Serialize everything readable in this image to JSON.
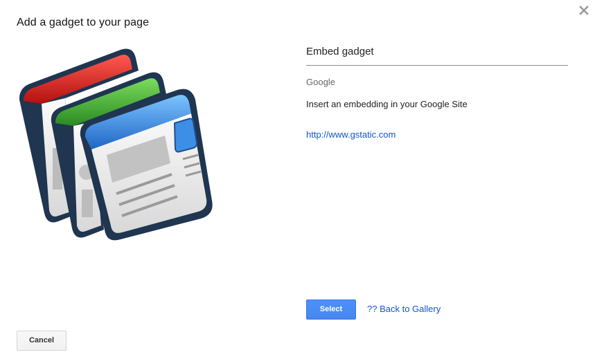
{
  "dialog": {
    "title": "Add a gadget to your page",
    "close_icon": "close-icon"
  },
  "gadget": {
    "name": "Embed gadget",
    "author": "Google",
    "description": "Insert an embedding in your Google Site",
    "url": "http://www.gstatic.com",
    "illustration_icon": "gadget-windows-icon",
    "colors": {
      "red": "#c4161c",
      "green": "#3a9d2e",
      "blue": "#2b78d8",
      "outline": "#1f3550"
    }
  },
  "actions": {
    "select_label": "Select",
    "back_label": "?? Back to Gallery",
    "cancel_label": "Cancel"
  },
  "colors": {
    "primary_button": "#4d90fe",
    "link": "#1155cc"
  }
}
